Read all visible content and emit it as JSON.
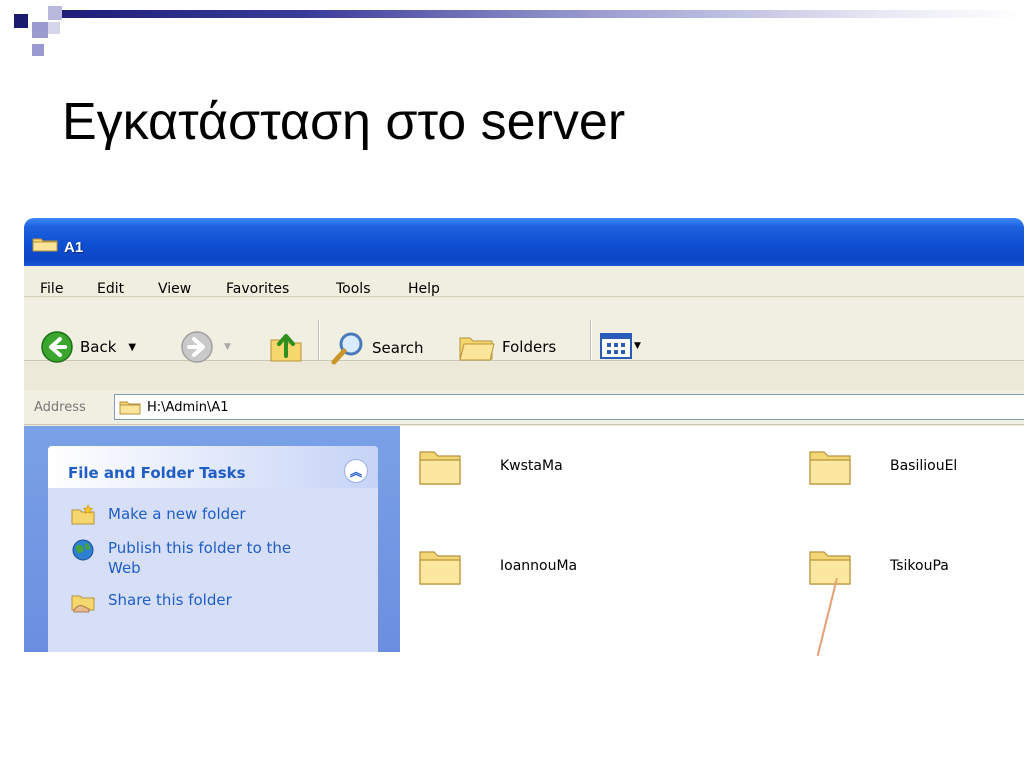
{
  "slide": {
    "title": "Εγκατάσταση στο server"
  },
  "window": {
    "title": "A1",
    "menu": [
      "File",
      "Edit",
      "View",
      "Favorites",
      "Tools",
      "Help"
    ],
    "toolbar": {
      "back": "Back",
      "search": "Search",
      "folders": "Folders"
    },
    "address": {
      "label": "Address",
      "path": "H:\\Admin\\A1"
    },
    "tasks": {
      "title": "File and Folder Tasks",
      "items": [
        "Make a new folder",
        "Publish this folder to the Web",
        "Share this folder"
      ]
    },
    "folders": [
      "KwstaMa",
      "BasiliouEl",
      "IoannouMa",
      "TsikouPa"
    ]
  },
  "colors": {
    "titlebar": "#0b46c4",
    "task_link": "#215dc6",
    "taskpane": "#6c8ee0"
  },
  "icons": [
    "folder-icon",
    "back-arrow-icon",
    "forward-arrow-icon",
    "up-folder-icon",
    "search-icon",
    "folders-icon",
    "views-icon",
    "new-folder-icon",
    "globe-icon",
    "share-folder-icon",
    "collapse-chevron-icon"
  ]
}
